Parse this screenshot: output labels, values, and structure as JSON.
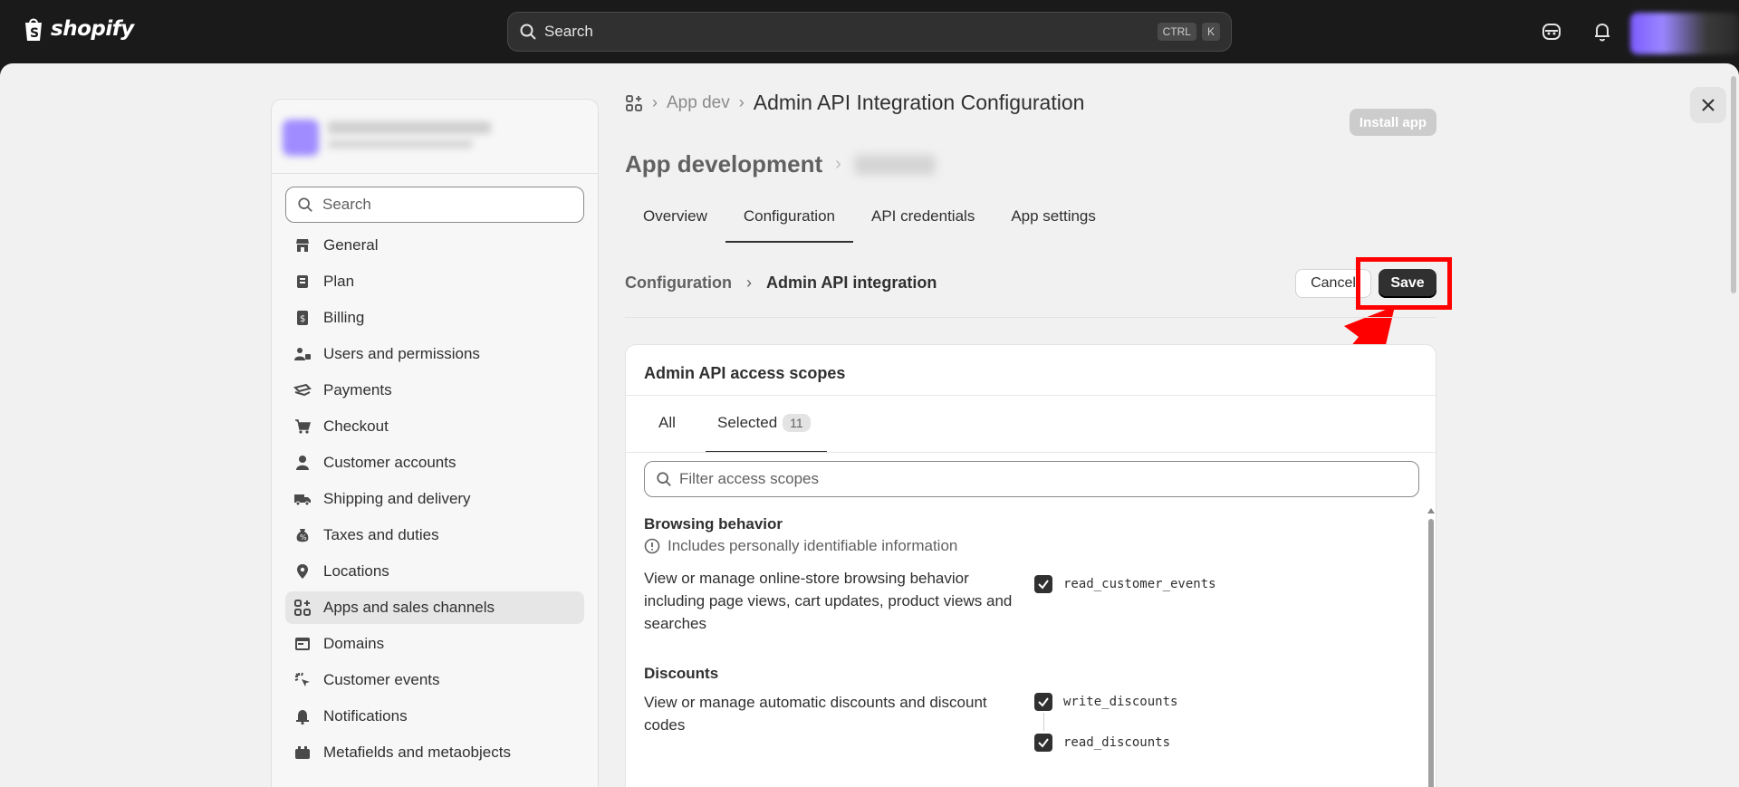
{
  "topbar": {
    "logo_text": "shopify",
    "search_placeholder": "Search",
    "shortcut_key1": "CTRL",
    "shortcut_key2": "K"
  },
  "sidebar": {
    "search_placeholder": "Search",
    "items": [
      {
        "label": "General",
        "icon": "store-icon"
      },
      {
        "label": "Plan",
        "icon": "plan-icon"
      },
      {
        "label": "Billing",
        "icon": "billing-icon"
      },
      {
        "label": "Users and permissions",
        "icon": "users-icon"
      },
      {
        "label": "Payments",
        "icon": "payments-icon"
      },
      {
        "label": "Checkout",
        "icon": "cart-icon"
      },
      {
        "label": "Customer accounts",
        "icon": "person-icon"
      },
      {
        "label": "Shipping and delivery",
        "icon": "truck-icon"
      },
      {
        "label": "Taxes and duties",
        "icon": "tax-icon"
      },
      {
        "label": "Locations",
        "icon": "location-icon"
      },
      {
        "label": "Apps and sales channels",
        "icon": "apps-icon"
      },
      {
        "label": "Domains",
        "icon": "domains-icon"
      },
      {
        "label": "Customer events",
        "icon": "events-icon"
      },
      {
        "label": "Notifications",
        "icon": "bell-icon"
      },
      {
        "label": "Metafields and metaobjects",
        "icon": "metafields-icon"
      }
    ],
    "active_index": 10
  },
  "header": {
    "breadcrumb_faded": "App dev",
    "breadcrumb_title": "Admin API Integration Configuration",
    "install_label": "Install app",
    "page_heading": "App development"
  },
  "tabs": [
    "Overview",
    "Configuration",
    "API credentials",
    "App settings"
  ],
  "active_tab": 1,
  "subheader": {
    "crumb1": "Configuration",
    "crumb2": "Admin API integration",
    "cancel_label": "Cancel",
    "save_label": "Save"
  },
  "card": {
    "title": "Admin API access scopes",
    "tab_all": "All",
    "tab_selected": "Selected",
    "selected_count": "11",
    "filter_placeholder": "Filter access scopes",
    "sections": [
      {
        "title": "Browsing behavior",
        "note": "Includes personally identifiable information",
        "description": "View or manage online-store browsing behavior including page views, cart updates, product views and searches",
        "scopes": [
          "read_customer_events"
        ]
      },
      {
        "title": "Discounts",
        "description": "View or manage automatic discounts and discount codes",
        "scopes": [
          "write_discounts",
          "read_discounts"
        ]
      }
    ]
  },
  "colors": {
    "highlight": "#ff0000",
    "primary_button": "#303030",
    "topbar": "#1a1a1a"
  }
}
